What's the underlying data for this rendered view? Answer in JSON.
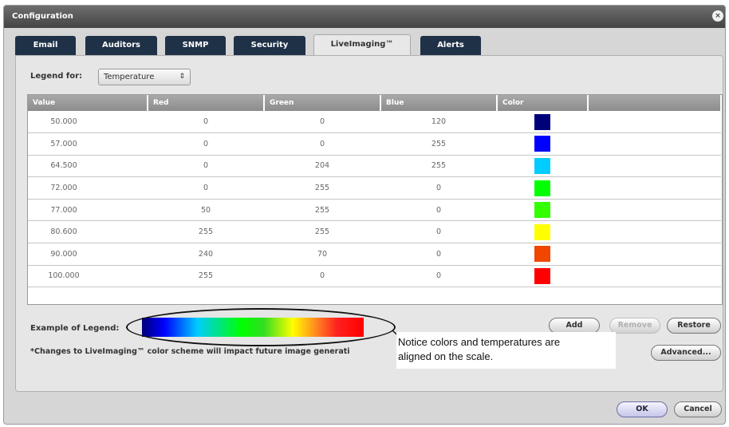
{
  "window": {
    "title": "Configuration",
    "close_glyph": "×"
  },
  "tabs": [
    {
      "label": "Email",
      "active": false
    },
    {
      "label": "Auditors",
      "active": false
    },
    {
      "label": "SNMP",
      "active": false
    },
    {
      "label": "Security",
      "active": false
    },
    {
      "label": "LiveImaging™",
      "active": true
    },
    {
      "label": "Alerts",
      "active": false
    }
  ],
  "legend_for": {
    "label": "Legend for:",
    "selected": "Temperature",
    "arrows": "⇕"
  },
  "table": {
    "headers": [
      "Value",
      "Red",
      "Green",
      "Blue",
      "Color",
      ""
    ],
    "rows": [
      {
        "value": "50.000",
        "red": "0",
        "green": "0",
        "blue": "120",
        "color": "#000078"
      },
      {
        "value": "57.000",
        "red": "0",
        "green": "0",
        "blue": "255",
        "color": "#0000ff"
      },
      {
        "value": "64.500",
        "red": "0",
        "green": "204",
        "blue": "255",
        "color": "#00ccff"
      },
      {
        "value": "72.000",
        "red": "0",
        "green": "255",
        "blue": "0",
        "color": "#00ff00"
      },
      {
        "value": "77.000",
        "red": "50",
        "green": "255",
        "blue": "0",
        "color": "#32ff00"
      },
      {
        "value": "80.600",
        "red": "255",
        "green": "255",
        "blue": "0",
        "color": "#ffff00"
      },
      {
        "value": "90.000",
        "red": "240",
        "green": "70",
        "blue": "0",
        "color": "#f04600"
      },
      {
        "value": "100.000",
        "red": "255",
        "green": "0",
        "blue": "0",
        "color": "#ff0000"
      }
    ]
  },
  "example_legend_label": "Example of Legend:",
  "note": "*Changes to LiveImaging™ color scheme will impact future image generati",
  "callout": {
    "line1": "Notice colors and temperatures are",
    "line2": "aligned on the scale."
  },
  "buttons": {
    "add": "Add",
    "remove": "Remove",
    "restore": "Restore",
    "advanced": "Advanced...",
    "ok": "OK",
    "cancel": "Cancel"
  }
}
